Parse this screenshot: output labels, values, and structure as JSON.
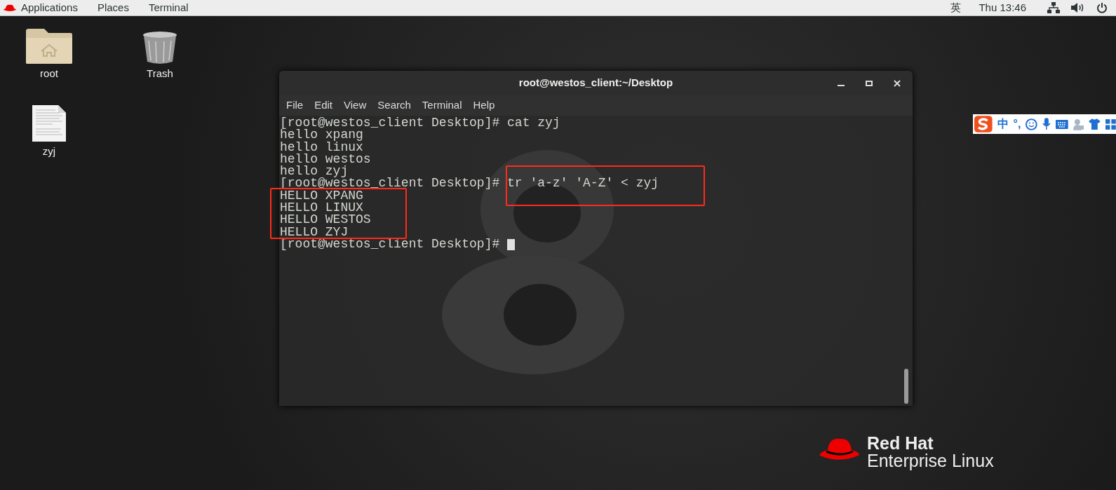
{
  "top_bar": {
    "menus": [
      "Applications",
      "Places",
      "Terminal"
    ],
    "input_method": "英",
    "clock": "Thu 13:46"
  },
  "desktop_icons": [
    {
      "kind": "folder",
      "label": "root"
    },
    {
      "kind": "trash",
      "label": "Trash"
    },
    {
      "kind": "document",
      "label": "zyj"
    }
  ],
  "terminal": {
    "title": "root@westos_client:~/Desktop",
    "menu": [
      "File",
      "Edit",
      "View",
      "Search",
      "Terminal",
      "Help"
    ],
    "lines": [
      "[root@westos_client Desktop]# cat zyj",
      "hello xpang",
      "hello linux",
      "hello westos",
      "hello zyj",
      "[root@westos_client Desktop]# tr 'a-z' 'A-Z' < zyj",
      "HELLO XPANG",
      "HELLO LINUX",
      "HELLO WESTOS",
      "HELLO ZYJ",
      "[root@westos_client Desktop]# "
    ]
  },
  "ime_toolbar": {
    "mode": "中",
    "punctuation": "°,"
  },
  "wallpaper_logo": {
    "brand": "Red Hat",
    "product": "Enterprise Linux"
  }
}
